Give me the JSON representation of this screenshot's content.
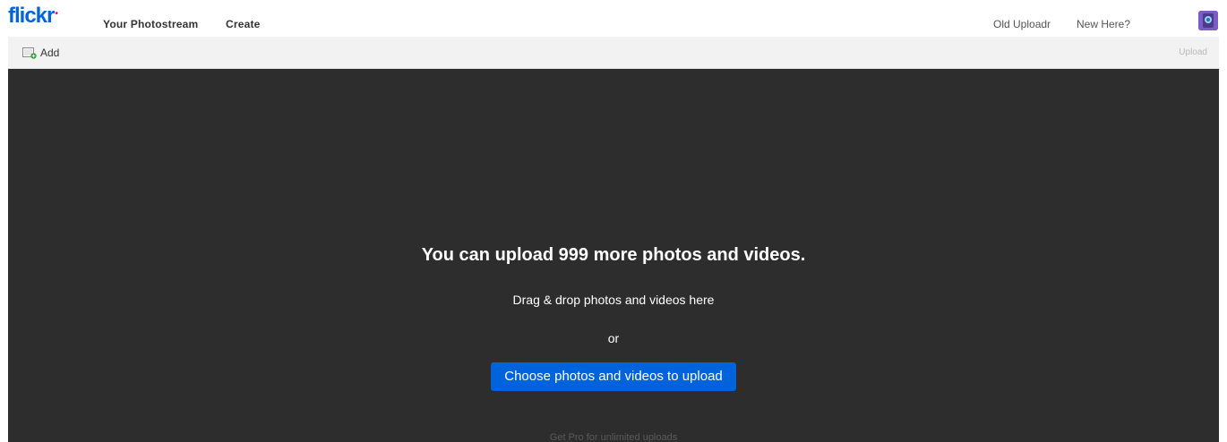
{
  "header": {
    "logo_text": "flickr",
    "logo_dot": "•",
    "nav": {
      "photostream": "Your Photostream",
      "create": "Create"
    },
    "right": {
      "old_uploadr": "Old Uploadr",
      "new_here": "New Here?"
    },
    "avatar_icon": "user-avatar-icon"
  },
  "toolbar": {
    "add_label": "Add",
    "add_icon": "add-photo-icon",
    "upload_label": "Upload"
  },
  "dropzone": {
    "headline": "You can upload 999 more photos and videos.",
    "drag_text": "Drag & drop photos and videos here",
    "or_text": "or",
    "choose_label": "Choose photos and videos to upload",
    "pro_text": "Get Pro for unlimited uploads"
  },
  "colors": {
    "brand_blue": "#0063dc",
    "brand_pink": "#ff0084",
    "dropzone_bg": "#2d2d2d",
    "toolbar_bg": "#f2f2f2"
  }
}
